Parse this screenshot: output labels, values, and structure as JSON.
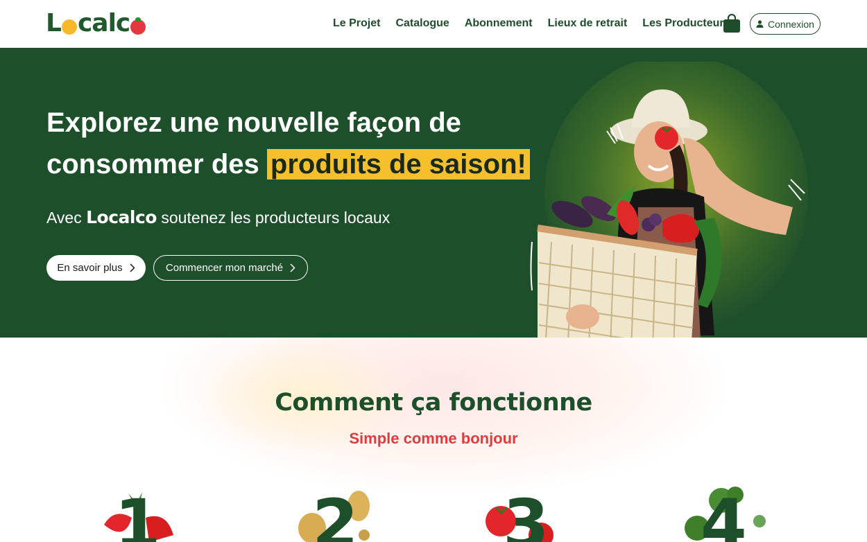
{
  "header": {
    "logo": {
      "part1": "L",
      "part2": "calc"
    },
    "nav": [
      "Le Projet",
      "Catalogue",
      "Abonnement",
      "Lieux de retrait",
      "Les Producteurs"
    ],
    "cart_icon": "shopping-bag-icon",
    "login_label": "Connexion",
    "login_icon": "user-icon"
  },
  "hero": {
    "title_part1": "Explorez une nouvelle façon de consommer des",
    "title_highlight": "produits de saison!",
    "subtitle_prefix": "Avec",
    "subtitle_brand": "Localco",
    "subtitle_suffix": "soutenez les producteurs locaux",
    "btn_primary": "En savoir plus",
    "btn_secondary": "Commencer mon marché",
    "colors": {
      "background": "#1e4f2b",
      "highlight": "#f6c02c"
    }
  },
  "how": {
    "title": "Comment ça fonctionne",
    "tagline": "Simple comme bonjour",
    "steps": [
      {
        "number": "1",
        "icon": "strawberry-icon"
      },
      {
        "number": "2",
        "icon": "potato-icon"
      },
      {
        "number": "3",
        "icon": "tomato-icon"
      },
      {
        "number": "4",
        "icon": "broccoli-icon"
      }
    ],
    "colors": {
      "title": "#1e4f2b",
      "tagline": "#e13a3f"
    }
  }
}
